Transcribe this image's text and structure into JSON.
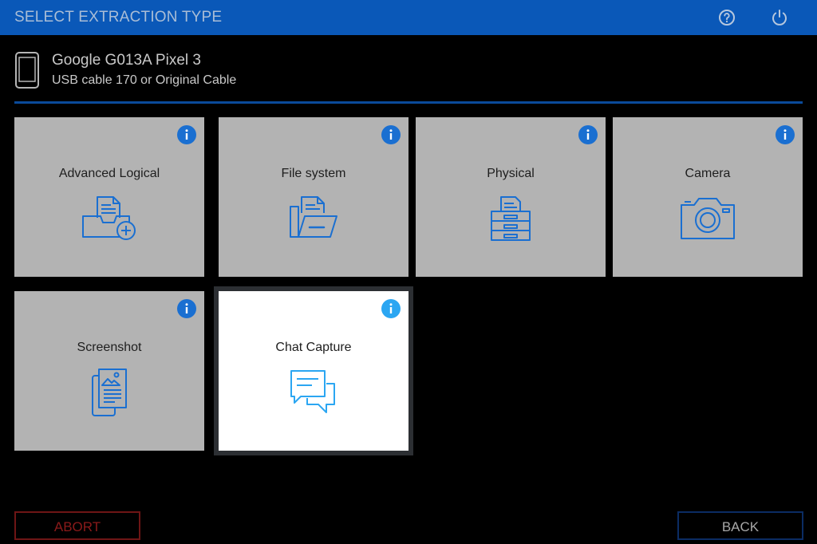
{
  "header": {
    "title": "SELECT EXTRACTION TYPE",
    "help_icon": "help-icon",
    "power_icon": "power-icon"
  },
  "device": {
    "name": "Google G013A Pixel 3",
    "connection": "USB cable 170 or Original Cable",
    "icon": "phone-icon"
  },
  "tiles": [
    {
      "label": "Advanced Logical",
      "icon": "inbox-add-icon",
      "selected": false
    },
    {
      "label": "File system",
      "icon": "folder-files-icon",
      "selected": false
    },
    {
      "label": "Physical",
      "icon": "cabinet-drawers-icon",
      "selected": false
    },
    {
      "label": "Camera",
      "icon": "camera-icon",
      "selected": false
    },
    {
      "label": "Screenshot",
      "icon": "screenshot-icon",
      "selected": false
    },
    {
      "label": "Chat Capture",
      "icon": "chat-bubbles-icon",
      "selected": true
    }
  ],
  "footer": {
    "abort_label": "ABORT",
    "back_label": "BACK"
  },
  "colors": {
    "header_bg": "#0a58b8",
    "accent_blue": "#1a6fd1",
    "selected_accent": "#2ba6f2",
    "tile_bg": "#b3b3b3",
    "selected_bg": "#ffffff",
    "abort_red": "#8b1a1a"
  }
}
